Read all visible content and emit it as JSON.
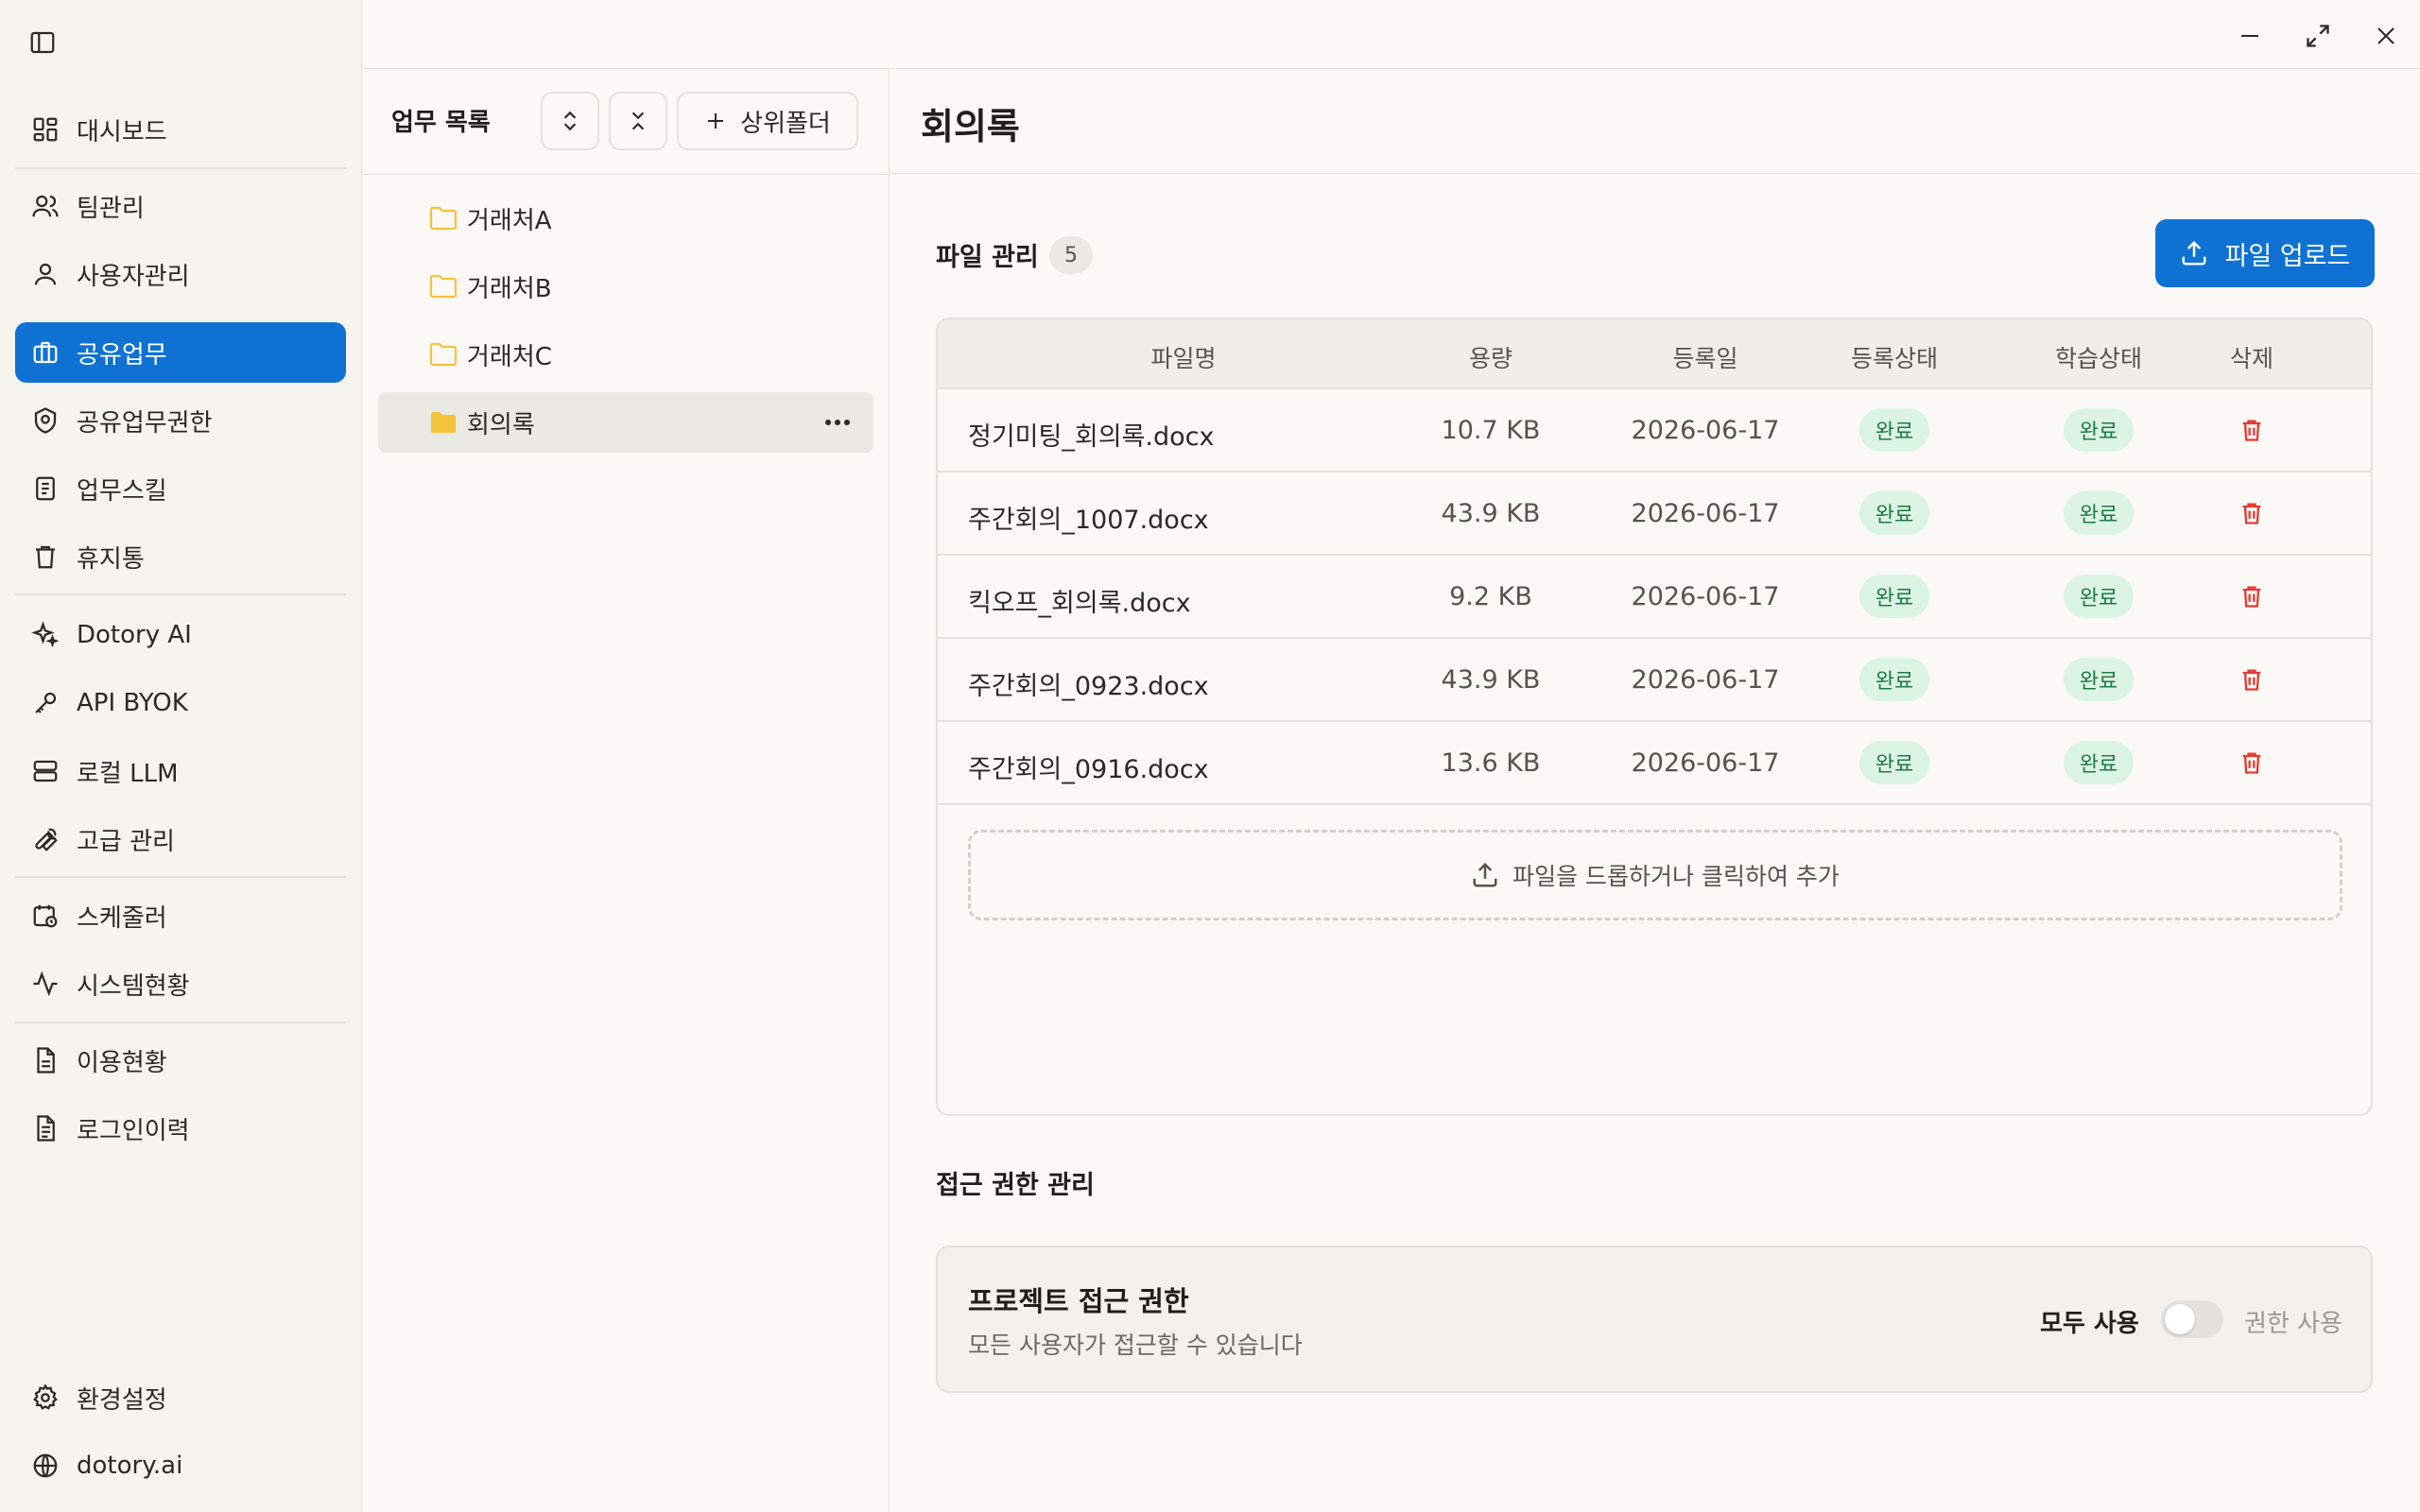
{
  "colors": {
    "accent": "#0f72d3",
    "success_bg": "#dcf4e4",
    "success_text": "#1c7a42",
    "danger": "#e53935",
    "folder": "#f5c23c"
  },
  "sidebar": {
    "toggle_icon": "sidebar-toggle-icon",
    "items": [
      {
        "label": "대시보드",
        "icon": "dashboard-icon"
      },
      {
        "label": "팀관리",
        "icon": "users-icon"
      },
      {
        "label": "사용자관리",
        "icon": "user-icon"
      },
      {
        "label": "공유업무",
        "icon": "briefcase-icon",
        "active": true
      },
      {
        "label": "공유업무권한",
        "icon": "shield-icon"
      },
      {
        "label": "업무스킬",
        "icon": "note-icon"
      },
      {
        "label": "휴지통",
        "icon": "trash-icon"
      },
      {
        "label": "Dotory AI",
        "icon": "sparkle-icon"
      },
      {
        "label": "API BYOK",
        "icon": "key-icon"
      },
      {
        "label": "로컬 LLM",
        "icon": "server-icon"
      },
      {
        "label": "고급 관리",
        "icon": "wrench-icon"
      },
      {
        "label": "스케줄러",
        "icon": "calendar-clock-icon"
      },
      {
        "label": "시스템현황",
        "icon": "activity-icon"
      },
      {
        "label": "이용현황",
        "icon": "file-text-icon"
      },
      {
        "label": "로그인이력",
        "icon": "file-list-icon"
      }
    ],
    "footer": [
      {
        "label": "환경설정",
        "icon": "gear-icon"
      },
      {
        "label": "dotory.ai",
        "icon": "globe-icon"
      }
    ]
  },
  "tree": {
    "title": "업무 목록",
    "add_parent_label": "상위폴더",
    "nodes": [
      {
        "label": "거래처A",
        "selected": false
      },
      {
        "label": "거래처B",
        "selected": false
      },
      {
        "label": "거래처C",
        "selected": false
      },
      {
        "label": "회의록",
        "selected": true
      }
    ]
  },
  "main": {
    "title": "회의록",
    "files_section": {
      "title": "파일 관리",
      "count": "5",
      "upload_label": "파일 업로드",
      "columns": [
        "파일명",
        "용량",
        "등록일",
        "등록상태",
        "학습상태",
        "삭제"
      ],
      "rows": [
        {
          "name": "정기미팅_회의록.docx",
          "size": "10.7 KB",
          "date": "2026-06-17",
          "reg": "완료",
          "learn": "완료"
        },
        {
          "name": "주간회의_1007.docx",
          "size": "43.9 KB",
          "date": "2026-06-17",
          "reg": "완료",
          "learn": "완료"
        },
        {
          "name": "킥오프_회의록.docx",
          "size": "9.2 KB",
          "date": "2026-06-17",
          "reg": "완료",
          "learn": "완료"
        },
        {
          "name": "주간회의_0923.docx",
          "size": "43.9 KB",
          "date": "2026-06-17",
          "reg": "완료",
          "learn": "완료"
        },
        {
          "name": "주간회의_0916.docx",
          "size": "13.6 KB",
          "date": "2026-06-17",
          "reg": "완료",
          "learn": "완료"
        }
      ],
      "dropzone_label": "파일을 드롭하거나 클릭하여 추가"
    },
    "access_section": {
      "title": "접근 권한 관리",
      "card_title": "프로젝트 접근 권한",
      "card_desc": "모든 사용자가 접근할 수 있습니다",
      "all_label": "모두 사용",
      "perm_label": "권한 사용",
      "toggle_on": false
    }
  }
}
